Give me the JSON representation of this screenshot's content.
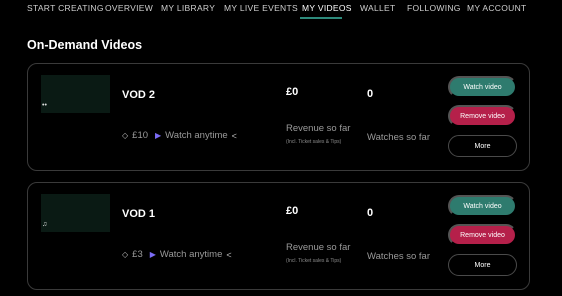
{
  "nav": {
    "items": [
      {
        "label": "START CREATING",
        "active": false
      },
      {
        "label": "OVERVIEW",
        "active": false
      },
      {
        "label": "MY LIBRARY",
        "active": false
      },
      {
        "label": "MY LIVE EVENTS",
        "active": false
      },
      {
        "label": "MY VIDEOS",
        "active": true
      },
      {
        "label": "WALLET",
        "active": false
      },
      {
        "label": "FOLLOWING",
        "active": false
      },
      {
        "label": "MY ACCOUNT",
        "active": false
      }
    ]
  },
  "page": {
    "title": "On-Demand Videos"
  },
  "videos": [
    {
      "title": "VOD 2",
      "thumb_icon": "••",
      "price": "£10",
      "availability": "Watch anytime",
      "revenue": "£0",
      "revenue_label": "Revenue so far",
      "revenue_sub": "(Incl. Ticket sales & Tips)",
      "watches": "0",
      "watches_label": "Watches so far",
      "watch_button": "Watch video",
      "remove_button": "Remove video",
      "more_button": "More"
    },
    {
      "title": "VOD 1",
      "thumb_icon": "♫",
      "price": "£3",
      "availability": "Watch anytime",
      "revenue": "£0",
      "revenue_label": "Revenue so far",
      "revenue_sub": "(Incl. Ticket sales & Tips)",
      "watches": "0",
      "watches_label": "Watches so far",
      "watch_button": "Watch video",
      "remove_button": "Remove video",
      "more_button": "More"
    }
  ],
  "icons": {
    "ticket": "ticket-icon",
    "play": "play-icon",
    "share": "share-icon"
  },
  "colors": {
    "accent": "#2e7b6e",
    "danger": "#b5204a",
    "play": "#7b6cf5"
  }
}
